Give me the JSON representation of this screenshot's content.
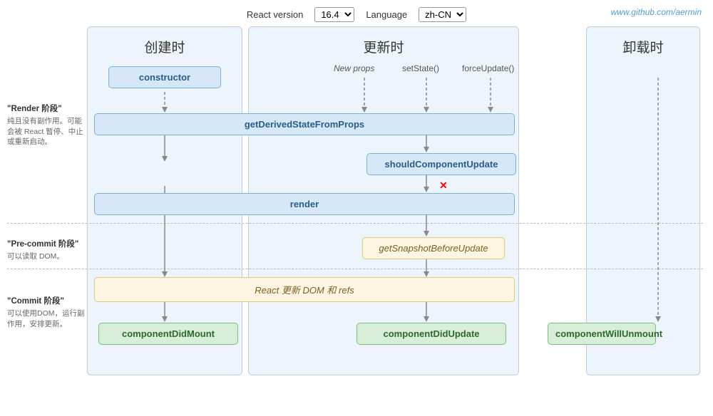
{
  "topbar": {
    "react_version_label": "React version",
    "react_version_value": "16.4",
    "language_label": "Language",
    "language_value": "zh-CN",
    "github": "www.github.com/aermin"
  },
  "columns": {
    "create": "创建时",
    "update": "更新时",
    "unmount": "卸载时"
  },
  "annotations": {
    "render_title": "\"Render 阶段\"",
    "render_desc": "纯且没有副作用。可能会被 React 暂停、中止或重新启动。",
    "precommit_title": "\"Pre-commit 阶段\"",
    "precommit_desc": "可以读取 DOM。",
    "commit_title": "\"Commit 阶段\"",
    "commit_desc": "可以使用DOM，运行副作用，安排更新。"
  },
  "boxes": {
    "constructor": "constructor",
    "getDerivedStateFromProps": "getDerivedStateFromProps",
    "shouldComponentUpdate": "shouldComponentUpdate",
    "render": "render",
    "getSnapshotBeforeUpdate": "getSnapshotBeforeUpdate",
    "reactUpdateDOM": "React 更新 DOM 和 refs",
    "componentDidMount": "componentDidMount",
    "componentDidUpdate": "componentDidUpdate",
    "componentWillUnmount": "componentWillUnmount",
    "newProps": "New props",
    "setState": "setState()",
    "forceUpdate": "forceUpdate()"
  }
}
